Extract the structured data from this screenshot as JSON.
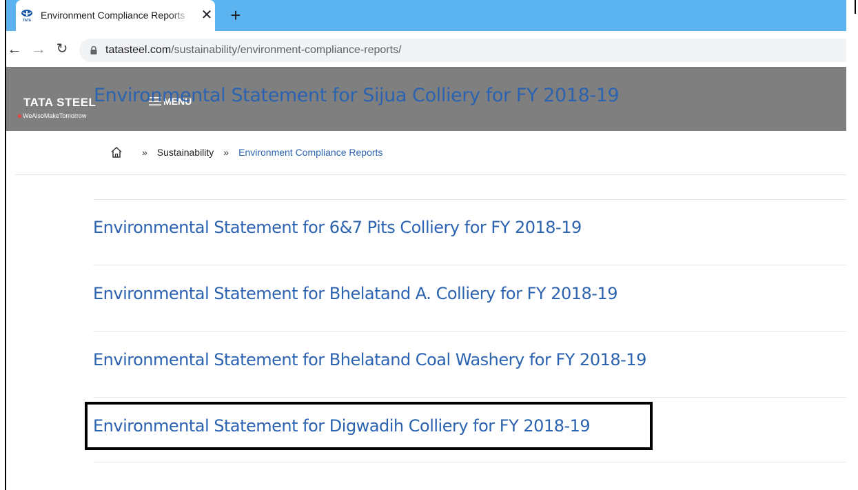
{
  "browser": {
    "tab_title": "Environment Compliance Reports",
    "tab_close": "✕",
    "new_tab": "+",
    "url_host": "tatasteel.com",
    "url_path": "/sustainability/environment-compliance-reports/",
    "back": "←",
    "forward": "→",
    "reload": "↻"
  },
  "header": {
    "logo": "TATA STEEL",
    "tagline": "WeAlsoMakeTomorrow",
    "menu_label": "MENU",
    "overlay_title": "Environmental Statement for Sijua Colliery for FY 2018-19"
  },
  "breadcrumb": {
    "sep": "»",
    "items": [
      "Sustainability",
      "Environment Compliance Reports"
    ]
  },
  "reports": [
    "Environmental Statement for 6&7 Pits Colliery for FY 2018-19",
    "Environmental Statement for Bhelatand A. Colliery for FY 2018-19",
    "Environmental Statement for Bhelatand Coal Washery for FY 2018-19",
    "Environmental Statement for Digwadih Colliery for FY 2018-19"
  ],
  "colors": {
    "tabbar": "#5bb4f0",
    "header_bg": "#7f7f7f",
    "link": "#2b63b0",
    "highlight_border": "#000000"
  }
}
